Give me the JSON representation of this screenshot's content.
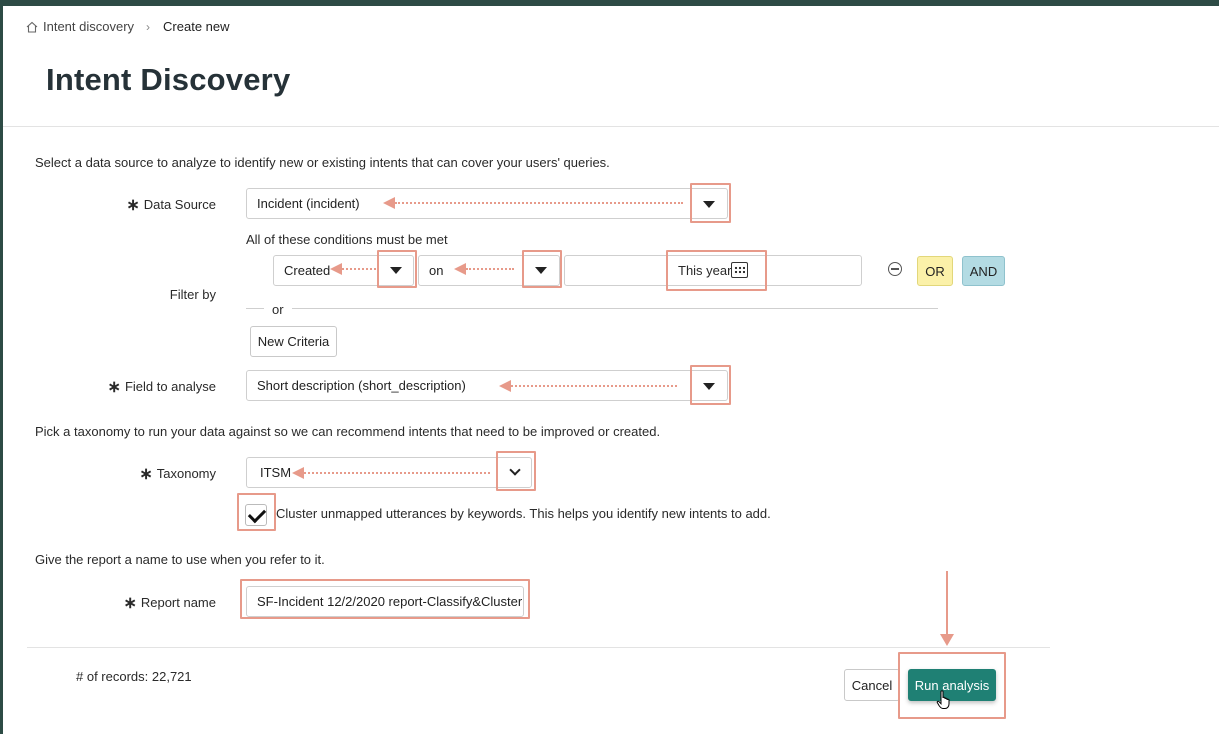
{
  "breadcrumb": {
    "home": "Intent discovery",
    "current": "Create new"
  },
  "page_title": "Intent Discovery",
  "intro_text": "Select a data source to analyze to identify new or existing intents that can cover your users' queries.",
  "data_source": {
    "label": "Data Source",
    "value": "Incident (incident)"
  },
  "filter": {
    "label": "Filter by",
    "conditions_text": "All of these conditions must be met",
    "field_value": "Created",
    "operator_value": "on",
    "date_value": "This year",
    "or_button": "OR",
    "and_button": "AND",
    "or_separator": "or",
    "new_criteria_button": "New Criteria"
  },
  "field_to_analyse": {
    "label": "Field to analyse",
    "value": "Short description (short_description)"
  },
  "taxonomy_intro": "Pick a taxonomy to run your data against so we can recommend intents that need to be improved or created.",
  "taxonomy": {
    "label": "Taxonomy",
    "value": "ITSM"
  },
  "cluster_checkbox": {
    "label": "Cluster unmapped utterances by keywords. This helps you identify new intents to add.",
    "checked": true
  },
  "report_intro": "Give the report a name to use when you refer to it.",
  "report_name": {
    "label": "Report name",
    "value": "SF-Incident 12/2/2020 report-Classify&Cluster"
  },
  "footer": {
    "records": "# of records: 22,721",
    "cancel": "Cancel",
    "run": "Run analysis"
  },
  "required_marker": "∗",
  "colors": {
    "accent": "#1f8074",
    "highlight": "#e79a8a",
    "or_bg": "#fbf1a9",
    "and_bg": "#b3dbe3",
    "topbar": "#2d4b45"
  },
  "icons": [
    "home-icon",
    "chevron-right-icon",
    "caret-down-icon",
    "calendar-icon",
    "remove-condition-icon",
    "checkmark-icon",
    "pointer-cursor-icon"
  ]
}
